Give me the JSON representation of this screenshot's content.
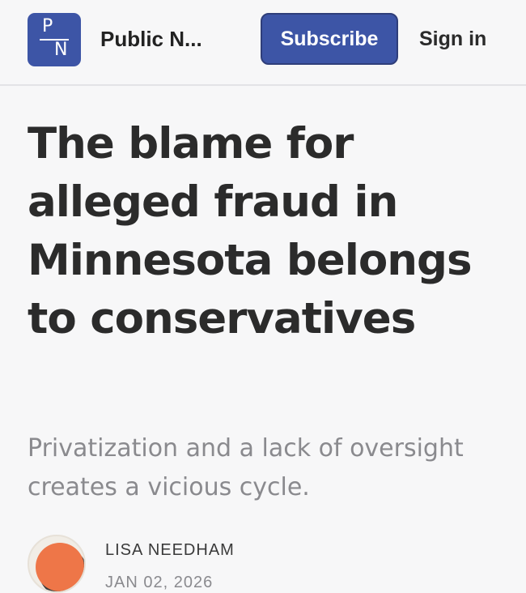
{
  "header": {
    "logo": {
      "top_letter": "P",
      "bottom_letter": "N"
    },
    "publication_name": "Public N...",
    "subscribe_label": "Subscribe",
    "signin_label": "Sign in"
  },
  "article": {
    "title": "The blame for alleged fraud in Minnesota belongs to conservatives",
    "subtitle": "Privatization and a lack of oversight creates a vicious cycle.",
    "author": "LISA NEEDHAM",
    "date": "JAN 02, 2026"
  },
  "colors": {
    "brand": "#3d55a6",
    "avatar_fill": "#ee7648",
    "text": "#2b2b2b",
    "muted": "#8a8a8e"
  }
}
